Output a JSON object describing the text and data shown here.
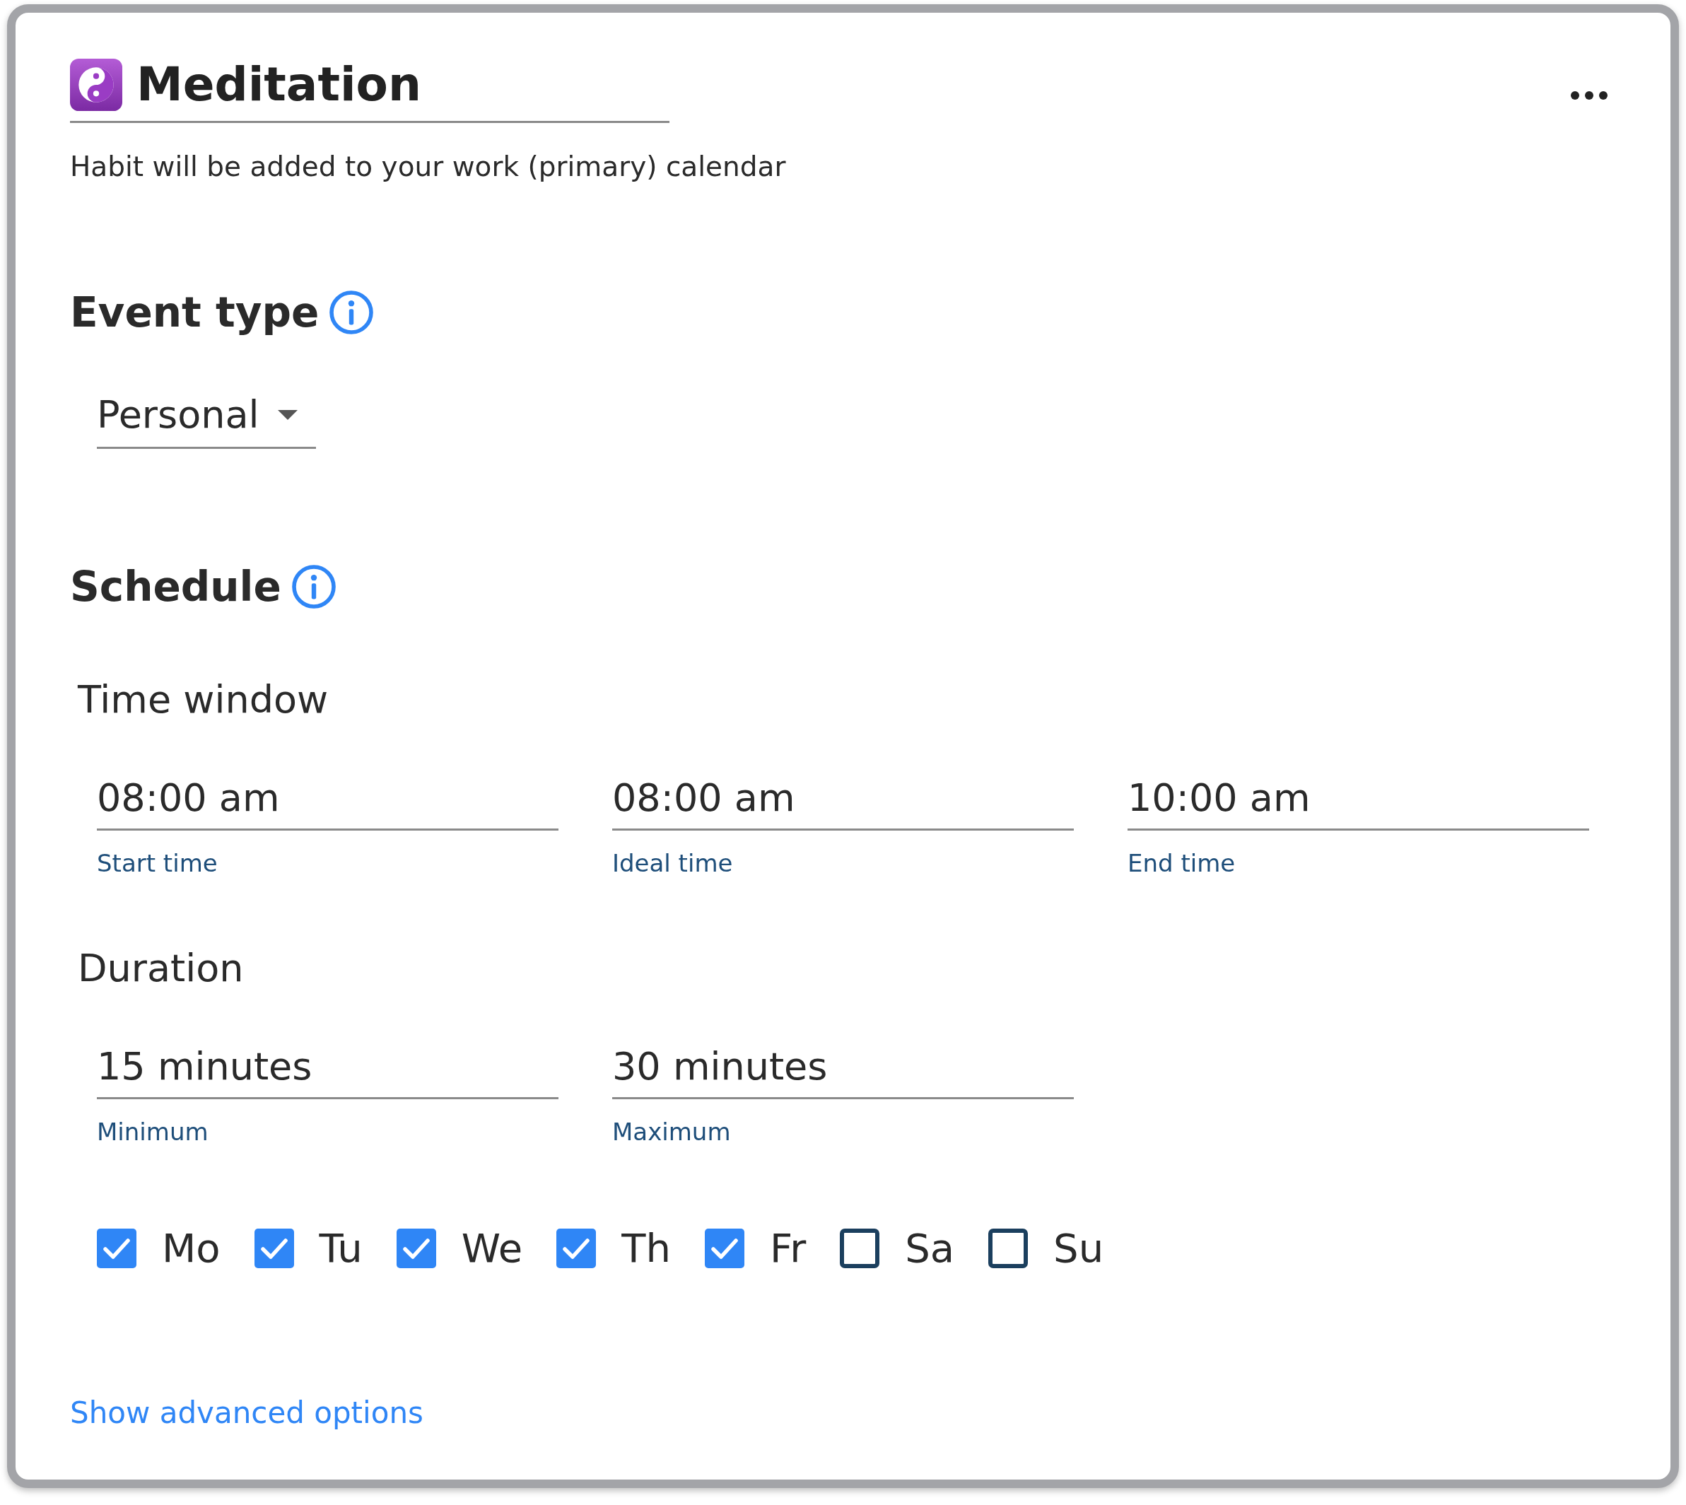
{
  "header": {
    "title": "Meditation",
    "subtitle": "Habit will be added to your work (primary) calendar"
  },
  "event_type": {
    "heading": "Event type",
    "value": "Personal"
  },
  "schedule": {
    "heading": "Schedule",
    "time_window": {
      "label": "Time window",
      "fields": [
        {
          "value": "08:00 am",
          "label": "Start time"
        },
        {
          "value": "08:00 am",
          "label": "Ideal time"
        },
        {
          "value": "10:00 am",
          "label": "End time"
        }
      ]
    },
    "duration": {
      "label": "Duration",
      "fields": [
        {
          "value": "15 minutes",
          "label": "Minimum"
        },
        {
          "value": "30 minutes",
          "label": "Maximum"
        }
      ]
    },
    "days": [
      {
        "label": "Mo",
        "checked": true
      },
      {
        "label": "Tu",
        "checked": true
      },
      {
        "label": "We",
        "checked": true
      },
      {
        "label": "Th",
        "checked": true
      },
      {
        "label": "Fr",
        "checked": true
      },
      {
        "label": "Sa",
        "checked": false
      },
      {
        "label": "Su",
        "checked": false
      }
    ]
  },
  "advanced_link": "Show advanced options"
}
